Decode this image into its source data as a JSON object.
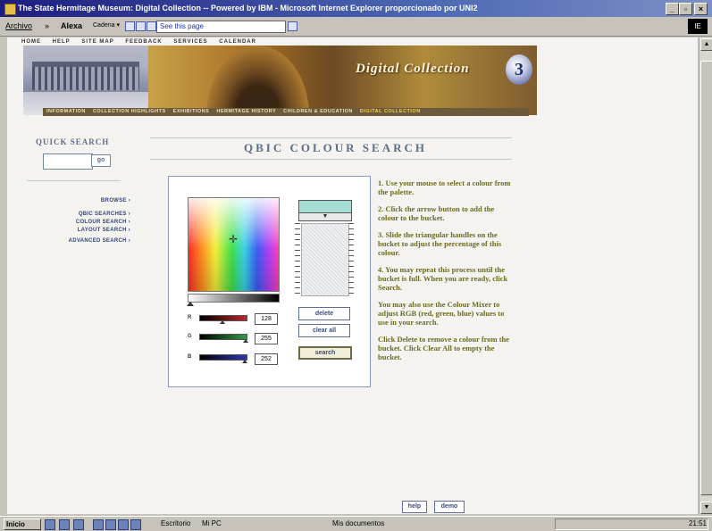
{
  "window": {
    "title": "The State Hermitage Museum: Digital Collection -- Powered by IBM - Microsoft Internet Explorer proporcionado por UNI2",
    "buttons": [
      "_",
      "▫",
      "×"
    ]
  },
  "toolbar": {
    "archivo": "Archivo",
    "chevron": "»",
    "alexa": "Alexa",
    "cadena": "Cadena ▾",
    "address": "See this page",
    "corner": "IE"
  },
  "topnav": [
    "HOME",
    "HELP",
    "SITE MAP",
    "FEEDBACK",
    "SERVICES",
    "CALENDAR"
  ],
  "banner": {
    "title": "Digital Collection",
    "logo": "3"
  },
  "section_nav": [
    {
      "label": "INFORMATION",
      "active": false
    },
    {
      "label": "COLLECTION HIGHLIGHTS",
      "active": false
    },
    {
      "label": "EXHIBITIONS",
      "active": false
    },
    {
      "label": "HERMITAGE HISTORY",
      "active": false
    },
    {
      "label": "CHILDREN & EDUCATION",
      "active": false
    },
    {
      "label": "DIGITAL COLLECTION",
      "active": true
    }
  ],
  "quick_search": {
    "title": "QUICK SEARCH",
    "value": "",
    "go": "go"
  },
  "side_links": {
    "browse": "BROWSE ›",
    "qbic": "QBIC SEARCHES ›",
    "colour": "COLOUR SEARCH ›",
    "layout": "LAYOUT SEARCH ›",
    "advanced": "ADVANCED SEARCH ›"
  },
  "main": {
    "title": "QBIC COLOUR SEARCH"
  },
  "mixer": {
    "r_label": "R",
    "g_label": "G",
    "b_label": "B",
    "r_value": "128",
    "g_value": "255",
    "b_value": "252",
    "r_fraction": 0.5,
    "g_fraction": 1.0,
    "b_fraction": 0.99,
    "selected_color": "#a5dcd4",
    "arrow": "▼",
    "delete": "delete",
    "clear_all": "clear all",
    "search": "search"
  },
  "instructions": {
    "p1": "1. Use your mouse to select a colour from the palette.",
    "p2": "2. Click the arrow button to add the colour to the bucket.",
    "p3": "3. Slide the triangular handles on the bucket to adjust the percentage of this colour.",
    "p4": "4. You may repeat this process until the bucket is full. When you are ready, click Search.",
    "p5": "You may also use the Colour Mixer to adjust RGB (red, green, blue) values to use in your search.",
    "p6": "Click Delete to remove a colour from the bucket. Click Clear All to empty the bucket."
  },
  "bottom": {
    "help": "help",
    "demo": "demo"
  },
  "taskbar": {
    "start": "Inicio",
    "escritorio": "Escritorio",
    "mipc": "Mi PC",
    "misdocs": "Mis documentos",
    "clock": "21:51"
  },
  "colors": {
    "title_blue": "#5c6e8b",
    "instruction_olive": "#6d6a22",
    "link_navy": "#2f4678"
  }
}
